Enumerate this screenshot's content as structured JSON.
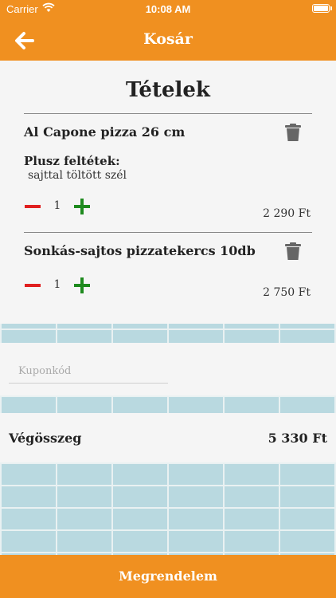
{
  "status_bar": {
    "carrier": "Carrier",
    "time": "10:08 AM"
  },
  "nav": {
    "title": "Kosár",
    "back_icon": "arrow-left-icon"
  },
  "colors": {
    "accent": "#F09020",
    "minus": "#E02020",
    "plus": "#1E8A1E",
    "trash": "#666666"
  },
  "items_section": {
    "title": "Tételek"
  },
  "items": [
    {
      "name": "Al Capone pizza 26 cm",
      "extras_label": "Plusz feltétek:",
      "extras": "sajttal töltött szél",
      "quantity": "1",
      "price": "2 290 Ft"
    },
    {
      "name": "Sonkás-sajtos pizzatekercs 10db",
      "quantity": "1",
      "price": "2 750 Ft"
    }
  ],
  "coupon": {
    "placeholder": "Kuponkód",
    "value": ""
  },
  "total": {
    "label": "Végösszeg",
    "value": "5 330 Ft"
  },
  "order_button": {
    "label": "Megrendelem"
  }
}
